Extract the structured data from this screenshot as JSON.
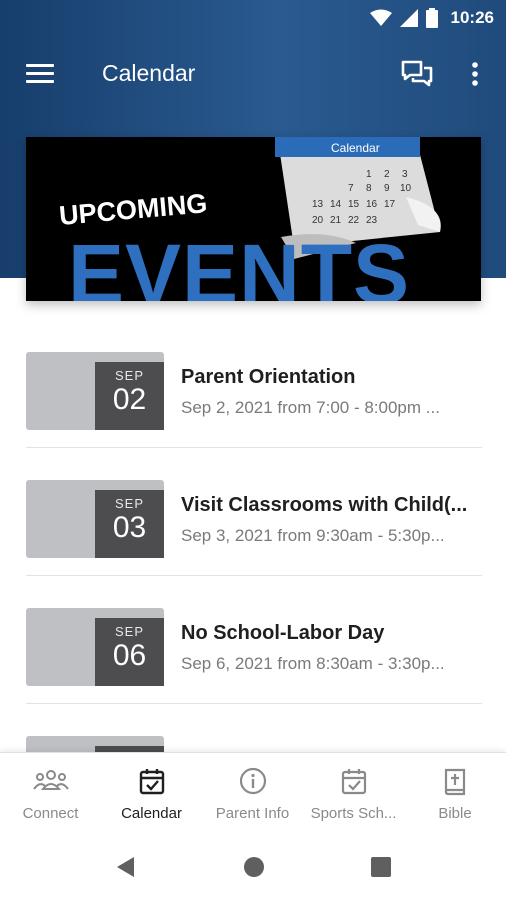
{
  "status": {
    "time": "10:26"
  },
  "appbar": {
    "title": "Calendar"
  },
  "banner": {
    "calendar_label": "Calendar",
    "line1": "UPCOMING",
    "line2": "EVENTS"
  },
  "events": [
    {
      "month": "SEP",
      "day": "02",
      "title": "Parent Orientation",
      "subtitle": "Sep 2, 2021 from 7:00 - 8:00pm ..."
    },
    {
      "month": "SEP",
      "day": "03",
      "title": "Visit Classrooms with Child(...",
      "subtitle": "Sep 3, 2021 from 9:30am - 5:30p..."
    },
    {
      "month": "SEP",
      "day": "06",
      "title": "No School-Labor Day",
      "subtitle": "Sep 6, 2021 from 8:30am - 3:30p..."
    }
  ],
  "bottom_nav": [
    {
      "label": "Connect",
      "icon": "people-icon"
    },
    {
      "label": "Calendar",
      "icon": "calendar-check-icon",
      "active": true
    },
    {
      "label": "Parent Info",
      "icon": "info-icon"
    },
    {
      "label": "Sports Sch...",
      "icon": "calendar-check-icon"
    },
    {
      "label": "Bible",
      "icon": "bible-icon"
    }
  ],
  "colors": {
    "header": "#1f4a7d",
    "datebox": "#4d4d4f",
    "thumb": "#bfc0c3",
    "banner_blue": "#2f6fbf"
  }
}
